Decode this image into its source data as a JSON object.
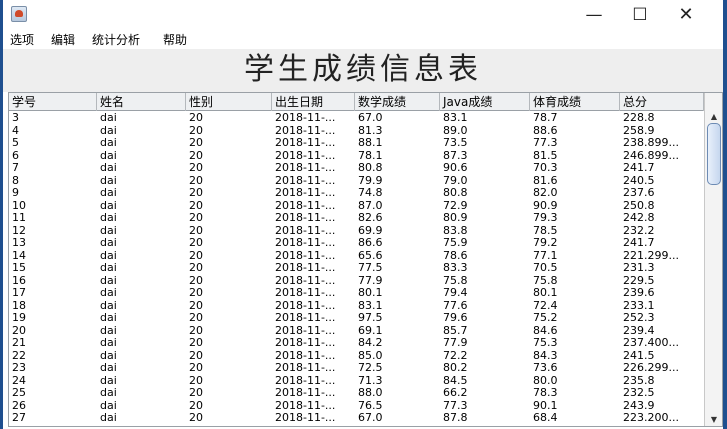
{
  "window": {
    "minimize_glyph": "—",
    "maximize_glyph": "☐",
    "close_glyph": "✕",
    "icon": "java-icon"
  },
  "menu": [
    "选项",
    "编辑",
    "统计分析",
    "帮助"
  ],
  "page_title": "学生成绩信息表",
  "table": {
    "columns": [
      "学号",
      "姓名",
      "性别",
      "出生日期",
      "数学成绩",
      "Java成绩",
      "体育成绩",
      "总分"
    ],
    "rows": [
      [
        "3",
        "dai",
        "20",
        "2018-11-...",
        "67.0",
        "83.1",
        "78.7",
        "228.8"
      ],
      [
        "4",
        "dai",
        "20",
        "2018-11-...",
        "81.3",
        "89.0",
        "88.6",
        "258.9"
      ],
      [
        "5",
        "dai",
        "20",
        "2018-11-...",
        "88.1",
        "73.5",
        "77.3",
        "238.899..."
      ],
      [
        "6",
        "dai",
        "20",
        "2018-11-...",
        "78.1",
        "87.3",
        "81.5",
        "246.899..."
      ],
      [
        "7",
        "dai",
        "20",
        "2018-11-...",
        "80.8",
        "90.6",
        "70.3",
        "241.7"
      ],
      [
        "8",
        "dai",
        "20",
        "2018-11-...",
        "79.9",
        "79.0",
        "81.6",
        "240.5"
      ],
      [
        "9",
        "dai",
        "20",
        "2018-11-...",
        "74.8",
        "80.8",
        "82.0",
        "237.6"
      ],
      [
        "10",
        "dai",
        "20",
        "2018-11-...",
        "87.0",
        "72.9",
        "90.9",
        "250.8"
      ],
      [
        "11",
        "dai",
        "20",
        "2018-11-...",
        "82.6",
        "80.9",
        "79.3",
        "242.8"
      ],
      [
        "12",
        "dai",
        "20",
        "2018-11-...",
        "69.9",
        "83.8",
        "78.5",
        "232.2"
      ],
      [
        "13",
        "dai",
        "20",
        "2018-11-...",
        "86.6",
        "75.9",
        "79.2",
        "241.7"
      ],
      [
        "14",
        "dai",
        "20",
        "2018-11-...",
        "65.6",
        "78.6",
        "77.1",
        "221.299..."
      ],
      [
        "15",
        "dai",
        "20",
        "2018-11-...",
        "77.5",
        "83.3",
        "70.5",
        "231.3"
      ],
      [
        "16",
        "dai",
        "20",
        "2018-11-...",
        "77.9",
        "75.8",
        "75.8",
        "229.5"
      ],
      [
        "17",
        "dai",
        "20",
        "2018-11-...",
        "80.1",
        "79.4",
        "80.1",
        "239.6"
      ],
      [
        "18",
        "dai",
        "20",
        "2018-11-...",
        "83.1",
        "77.6",
        "72.4",
        "233.1"
      ],
      [
        "19",
        "dai",
        "20",
        "2018-11-...",
        "97.5",
        "79.6",
        "75.2",
        "252.3"
      ],
      [
        "20",
        "dai",
        "20",
        "2018-11-...",
        "69.1",
        "85.7",
        "84.6",
        "239.4"
      ],
      [
        "21",
        "dai",
        "20",
        "2018-11-...",
        "84.2",
        "77.9",
        "75.3",
        "237.400..."
      ],
      [
        "22",
        "dai",
        "20",
        "2018-11-...",
        "85.0",
        "72.2",
        "84.3",
        "241.5"
      ],
      [
        "23",
        "dai",
        "20",
        "2018-11-...",
        "72.5",
        "80.2",
        "73.6",
        "226.299..."
      ],
      [
        "24",
        "dai",
        "20",
        "2018-11-...",
        "71.3",
        "84.5",
        "80.0",
        "235.8"
      ],
      [
        "25",
        "dai",
        "20",
        "2018-11-...",
        "88.0",
        "66.2",
        "78.3",
        "232.5"
      ],
      [
        "26",
        "dai",
        "20",
        "2018-11-...",
        "76.5",
        "77.3",
        "90.1",
        "243.9"
      ],
      [
        "27",
        "dai",
        "20",
        "2018-11-...",
        "67.0",
        "87.8",
        "68.4",
        "223.200..."
      ]
    ]
  },
  "scrollbar": {
    "up_glyph": "▲",
    "down_glyph": "▼"
  }
}
